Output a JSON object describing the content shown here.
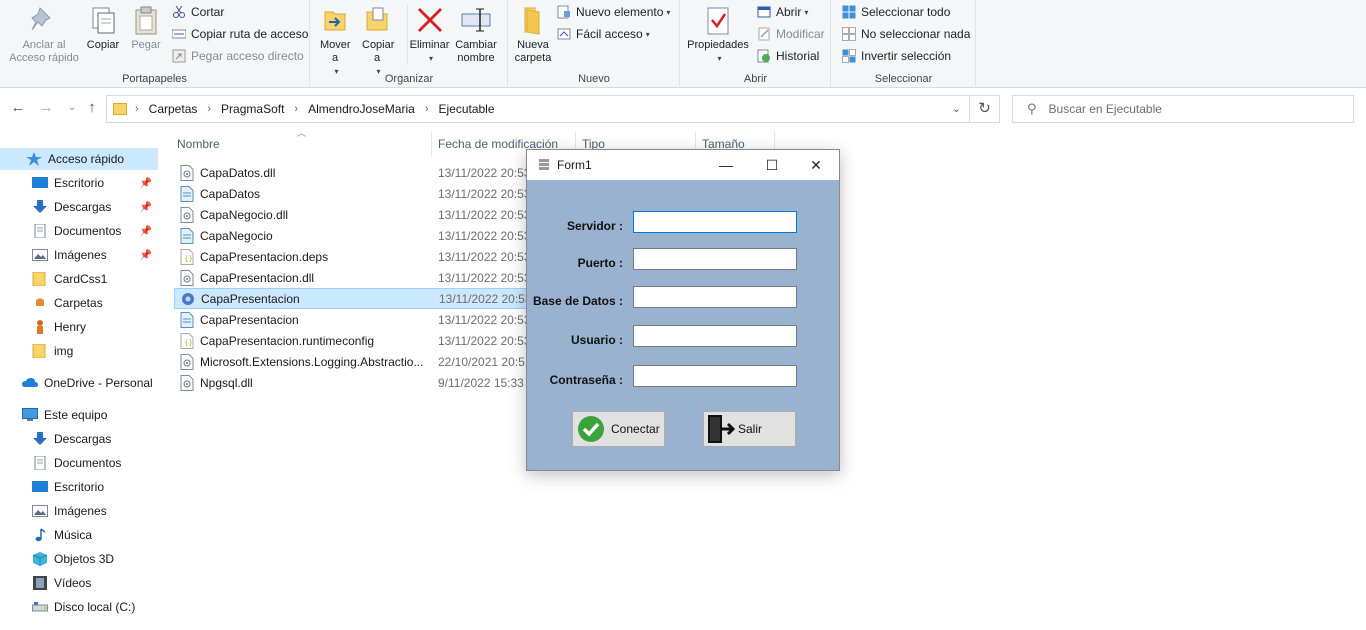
{
  "ribbon": {
    "portapapeles": {
      "label": "Portapapeles",
      "anclar": "Anclar al Acceso rápido",
      "copiar": "Copiar",
      "pegar": "Pegar",
      "cortar": "Cortar",
      "copiar_ruta": "Copiar ruta de acceso",
      "pegar_acceso": "Pegar acceso directo"
    },
    "organizar": {
      "label": "Organizar",
      "mover": "Mover a",
      "copiar_a": "Copiar a",
      "eliminar": "Eliminar",
      "cambiar": "Cambiar nombre"
    },
    "nuevo": {
      "label": "Nuevo",
      "nueva_carpeta": "Nueva carpeta",
      "nuevo_elemento": "Nuevo elemento",
      "facil_acceso": "Fácil acceso"
    },
    "abrir": {
      "label": "Abrir",
      "propiedades": "Propiedades",
      "abrir": "Abrir",
      "modificar": "Modificar",
      "historial": "Historial"
    },
    "seleccionar": {
      "label": "Seleccionar",
      "todo": "Seleccionar todo",
      "nada": "No seleccionar nada",
      "invertir": "Invertir selección"
    }
  },
  "address": {
    "crumbs": [
      "Carpetas",
      "PragmaSoft",
      "AlmendroJoseMaria",
      "Ejecutable"
    ],
    "search_placeholder": "Buscar en Ejecutable"
  },
  "sidebar": {
    "items": [
      {
        "label": "Acceso rápido",
        "icon": "star-icon"
      },
      {
        "label": "Escritorio",
        "icon": "desktop-icon"
      },
      {
        "label": "Descargas",
        "icon": "download-icon"
      },
      {
        "label": "Documentos",
        "icon": "documents-icon"
      },
      {
        "label": "Imágenes",
        "icon": "pictures-icon"
      },
      {
        "label": "CardCss1",
        "icon": "folder-icon"
      },
      {
        "label": "Carpetas",
        "icon": "folder-icon"
      },
      {
        "label": "Henry",
        "icon": "folder-icon"
      },
      {
        "label": "img",
        "icon": "folder-icon"
      },
      {
        "label": "OneDrive - Personal",
        "icon": "cloud-icon"
      },
      {
        "label": "Este equipo",
        "icon": "computer-icon"
      },
      {
        "label": "Descargas",
        "icon": "download-icon"
      },
      {
        "label": "Documentos",
        "icon": "documents-icon"
      },
      {
        "label": "Escritorio",
        "icon": "desktop-icon"
      },
      {
        "label": "Imágenes",
        "icon": "pictures-icon"
      },
      {
        "label": "Música",
        "icon": "music-icon"
      },
      {
        "label": "Objetos 3D",
        "icon": "3d-objects-icon"
      },
      {
        "label": "Vídeos",
        "icon": "videos-icon"
      },
      {
        "label": "Disco local (C:)",
        "icon": "drive-icon"
      }
    ]
  },
  "columns": {
    "nombre": "Nombre",
    "fecha": "Fecha de modificación",
    "tipo": "Tipo",
    "tamano": "Tamaño"
  },
  "files": [
    {
      "name": "CapaDatos.dll",
      "date": "13/11/2022 20:53",
      "icon": "dll-icon"
    },
    {
      "name": "CapaDatos",
      "date": "13/11/2022 20:53",
      "icon": "pdb-icon"
    },
    {
      "name": "CapaNegocio.dll",
      "date": "13/11/2022 20:53",
      "icon": "dll-icon"
    },
    {
      "name": "CapaNegocio",
      "date": "13/11/2022 20:53",
      "icon": "pdb-icon"
    },
    {
      "name": "CapaPresentacion.deps",
      "date": "13/11/2022 20:53",
      "icon": "json-icon"
    },
    {
      "name": "CapaPresentacion.dll",
      "date": "13/11/2022 20:53",
      "icon": "dll-icon"
    },
    {
      "name": "CapaPresentacion",
      "date": "13/11/2022 20:53",
      "icon": "exe-icon"
    },
    {
      "name": "CapaPresentacion",
      "date": "13/11/2022 20:53",
      "icon": "pdb-icon"
    },
    {
      "name": "CapaPresentacion.runtimeconfig",
      "date": "13/11/2022 20:53",
      "icon": "json-icon"
    },
    {
      "name": "Microsoft.Extensions.Logging.Abstractio...",
      "date": "22/10/2021 20:51",
      "icon": "dll-icon"
    },
    {
      "name": "Npgsql.dll",
      "date": "9/11/2022 15:33",
      "icon": "dll-icon"
    }
  ],
  "form": {
    "title": "Form1",
    "servidor": "Servidor :",
    "puerto": "Puerto :",
    "base": "Base de Datos :",
    "usuario": "Usuario :",
    "contrasena": "Contraseña :",
    "conectar": "Conectar",
    "salir": "Salir"
  },
  "colors": {
    "selection": "#cce8ff",
    "form_background": "#98b2d0",
    "focus": "#0078d7"
  }
}
